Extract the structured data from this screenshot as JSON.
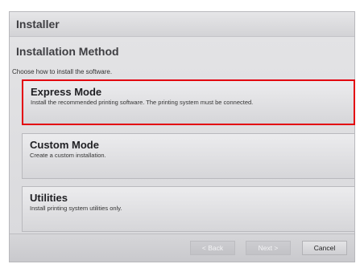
{
  "window": {
    "title": "Installer"
  },
  "page": {
    "heading": "Installation Method",
    "subheading": "Choose how to install the software."
  },
  "options": [
    {
      "title": "Express Mode",
      "description": "Install the recommended printing software. The printing system must be connected.",
      "selected": true
    },
    {
      "title": "Custom Mode",
      "description": "Create a custom installation.",
      "selected": false
    },
    {
      "title": "Utilities",
      "description": "Install printing system utilities only.",
      "selected": false
    }
  ],
  "buttons": {
    "back": "< Back",
    "next": "Next >",
    "cancel": "Cancel"
  },
  "colors": {
    "selection_highlight": "#e3000f",
    "window_background": "#dcdcdf"
  }
}
